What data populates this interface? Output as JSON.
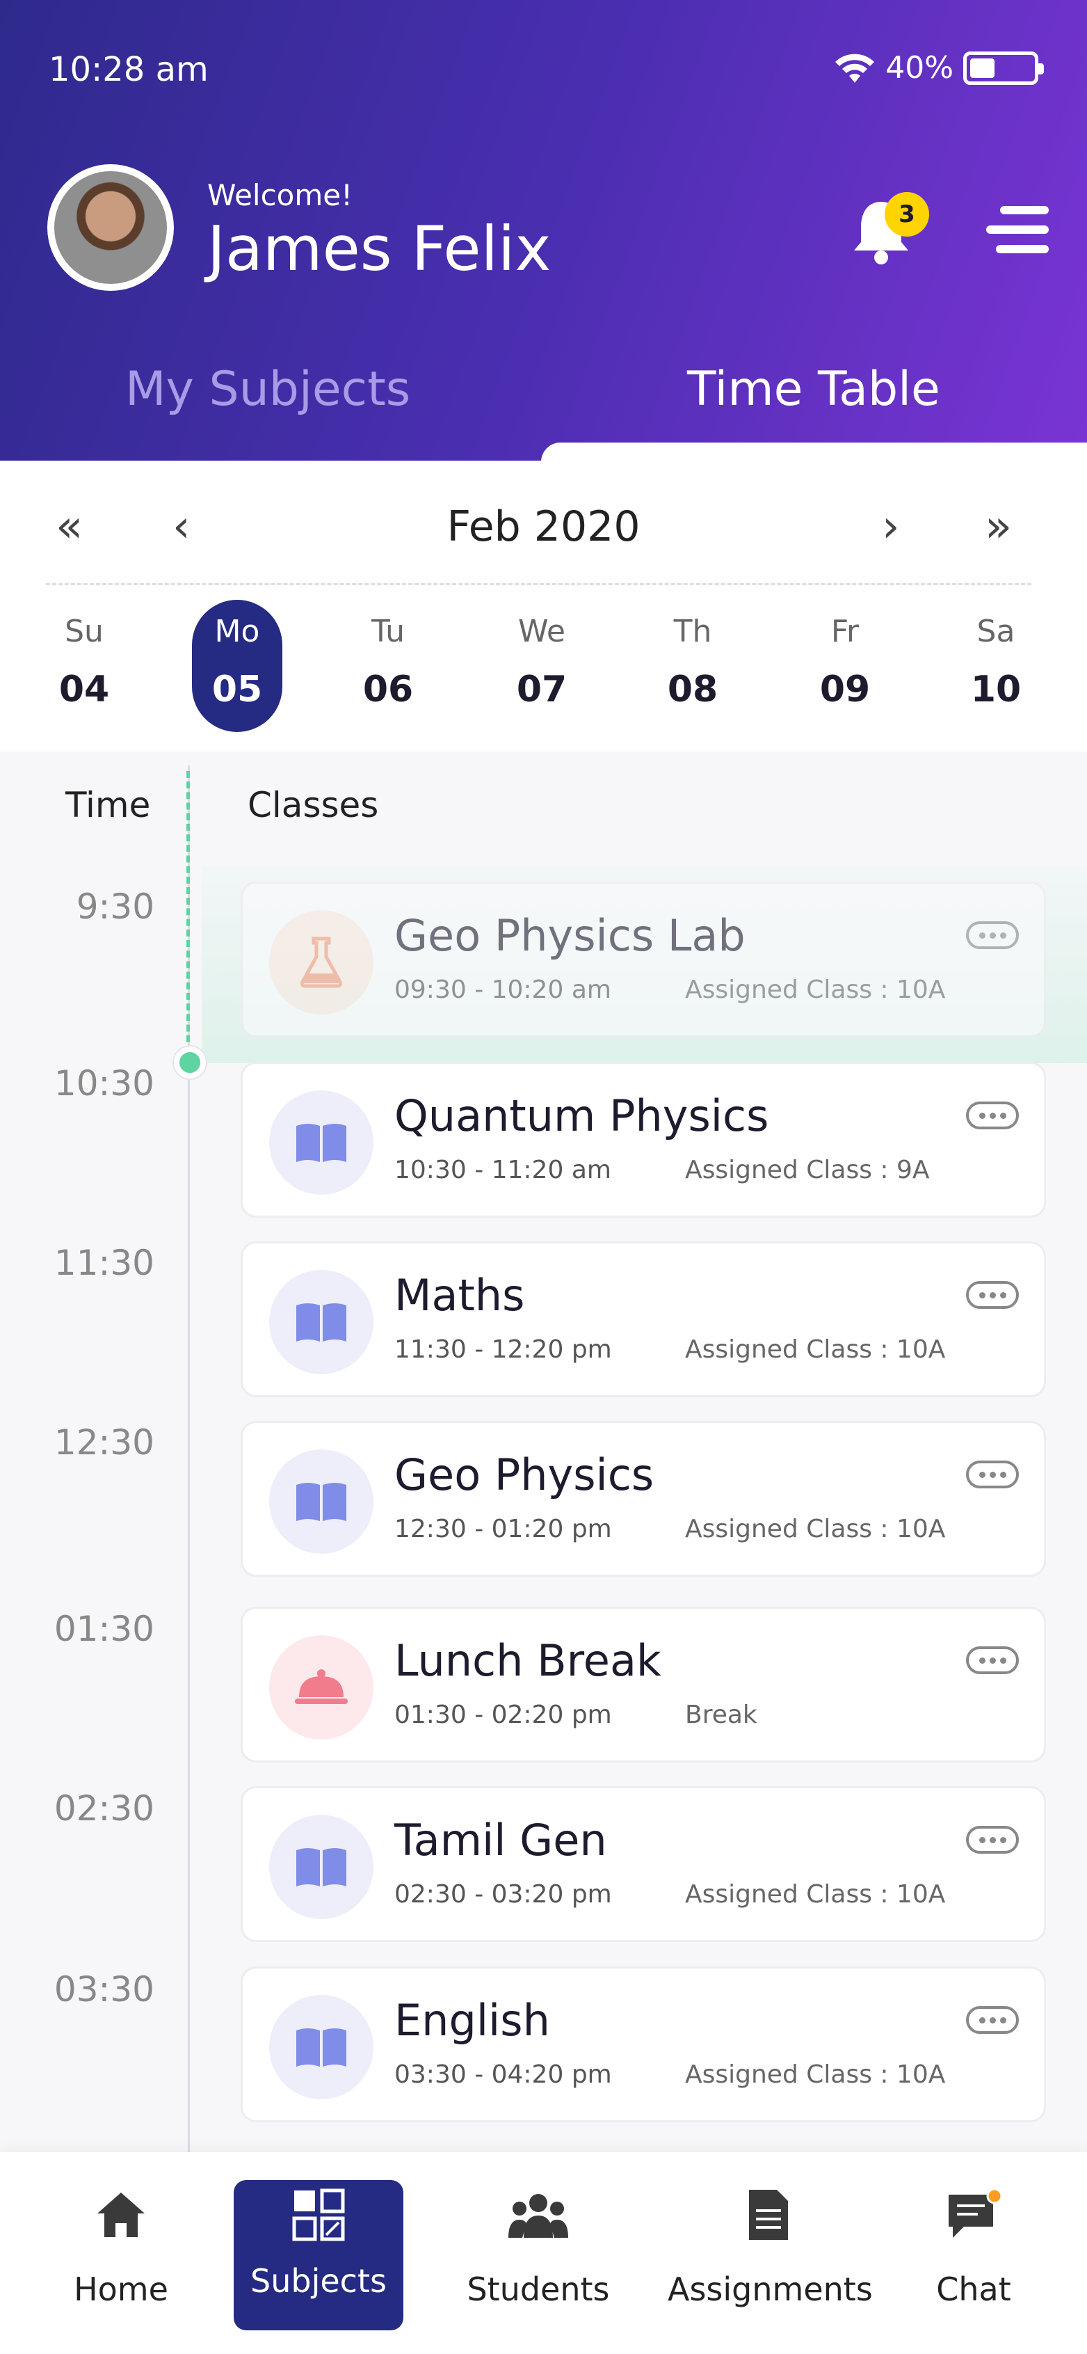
{
  "status_bar": {
    "time": "10:28 am",
    "battery": "40%",
    "battery_level": 0.4
  },
  "header": {
    "welcome": "Welcome!",
    "user_name": "James Felix",
    "notification_count": "3"
  },
  "tabs": [
    {
      "label": "My Subjects",
      "active": false
    },
    {
      "label": "Time Table",
      "active": true
    }
  ],
  "calendar": {
    "month": "Feb 2020",
    "days": [
      {
        "name": "Su",
        "num": "04"
      },
      {
        "name": "Mo",
        "num": "05",
        "active": true
      },
      {
        "name": "Tu",
        "num": "06"
      },
      {
        "name": "We",
        "num": "07"
      },
      {
        "name": "Th",
        "num": "08"
      },
      {
        "name": "Fr",
        "num": "09"
      },
      {
        "name": "Sa",
        "num": "10"
      }
    ]
  },
  "schedule": {
    "time_header": "Time",
    "classes_header": "Classes",
    "times": [
      "9:30",
      "10:30",
      "11:30",
      "12:30",
      "01:30",
      "02:30",
      "03:30"
    ],
    "classes": [
      {
        "title": "Geo Physics Lab",
        "time": "09:30 - 10:20 am",
        "assigned": "Assigned Class : 10A",
        "icon": "flask-icon",
        "past": true
      },
      {
        "title": "Quantum Physics",
        "time": "10:30 - 11:20 am",
        "assigned": "Assigned Class : 9A",
        "icon": "book-icon"
      },
      {
        "title": "Maths",
        "time": "11:30 - 12:20 pm",
        "assigned": "Assigned Class : 10A",
        "icon": "book-icon"
      },
      {
        "title": "Geo Physics",
        "time": "12:30 - 01:20 pm",
        "assigned": "Assigned Class : 10A",
        "icon": "book-icon"
      },
      {
        "title": "Lunch Break",
        "time": "01:30 - 02:20 pm",
        "assigned": "Break",
        "icon": "cloche-icon"
      },
      {
        "title": "Tamil Gen",
        "time": "02:30 - 03:20 pm",
        "assigned": "Assigned Class : 10A",
        "icon": "book-icon"
      },
      {
        "title": "English",
        "time": "03:30 - 04:20 pm",
        "assigned": "Assigned Class : 10A",
        "icon": "book-icon"
      }
    ]
  },
  "bottom_nav": [
    {
      "label": "Home",
      "icon": "home-icon"
    },
    {
      "label": "Subjects",
      "icon": "subjects-icon",
      "active": true
    },
    {
      "label": "Students",
      "icon": "students-icon"
    },
    {
      "label": "Assignments",
      "icon": "assignments-icon"
    },
    {
      "label": "Chat",
      "icon": "chat-icon"
    }
  ],
  "colors": {
    "header_start": "#2e2a8c",
    "header_end": "#7a34d4",
    "active_navy": "#252a82",
    "timeline_green": "#5fd3a2",
    "badge_yellow": "#ffd400"
  }
}
